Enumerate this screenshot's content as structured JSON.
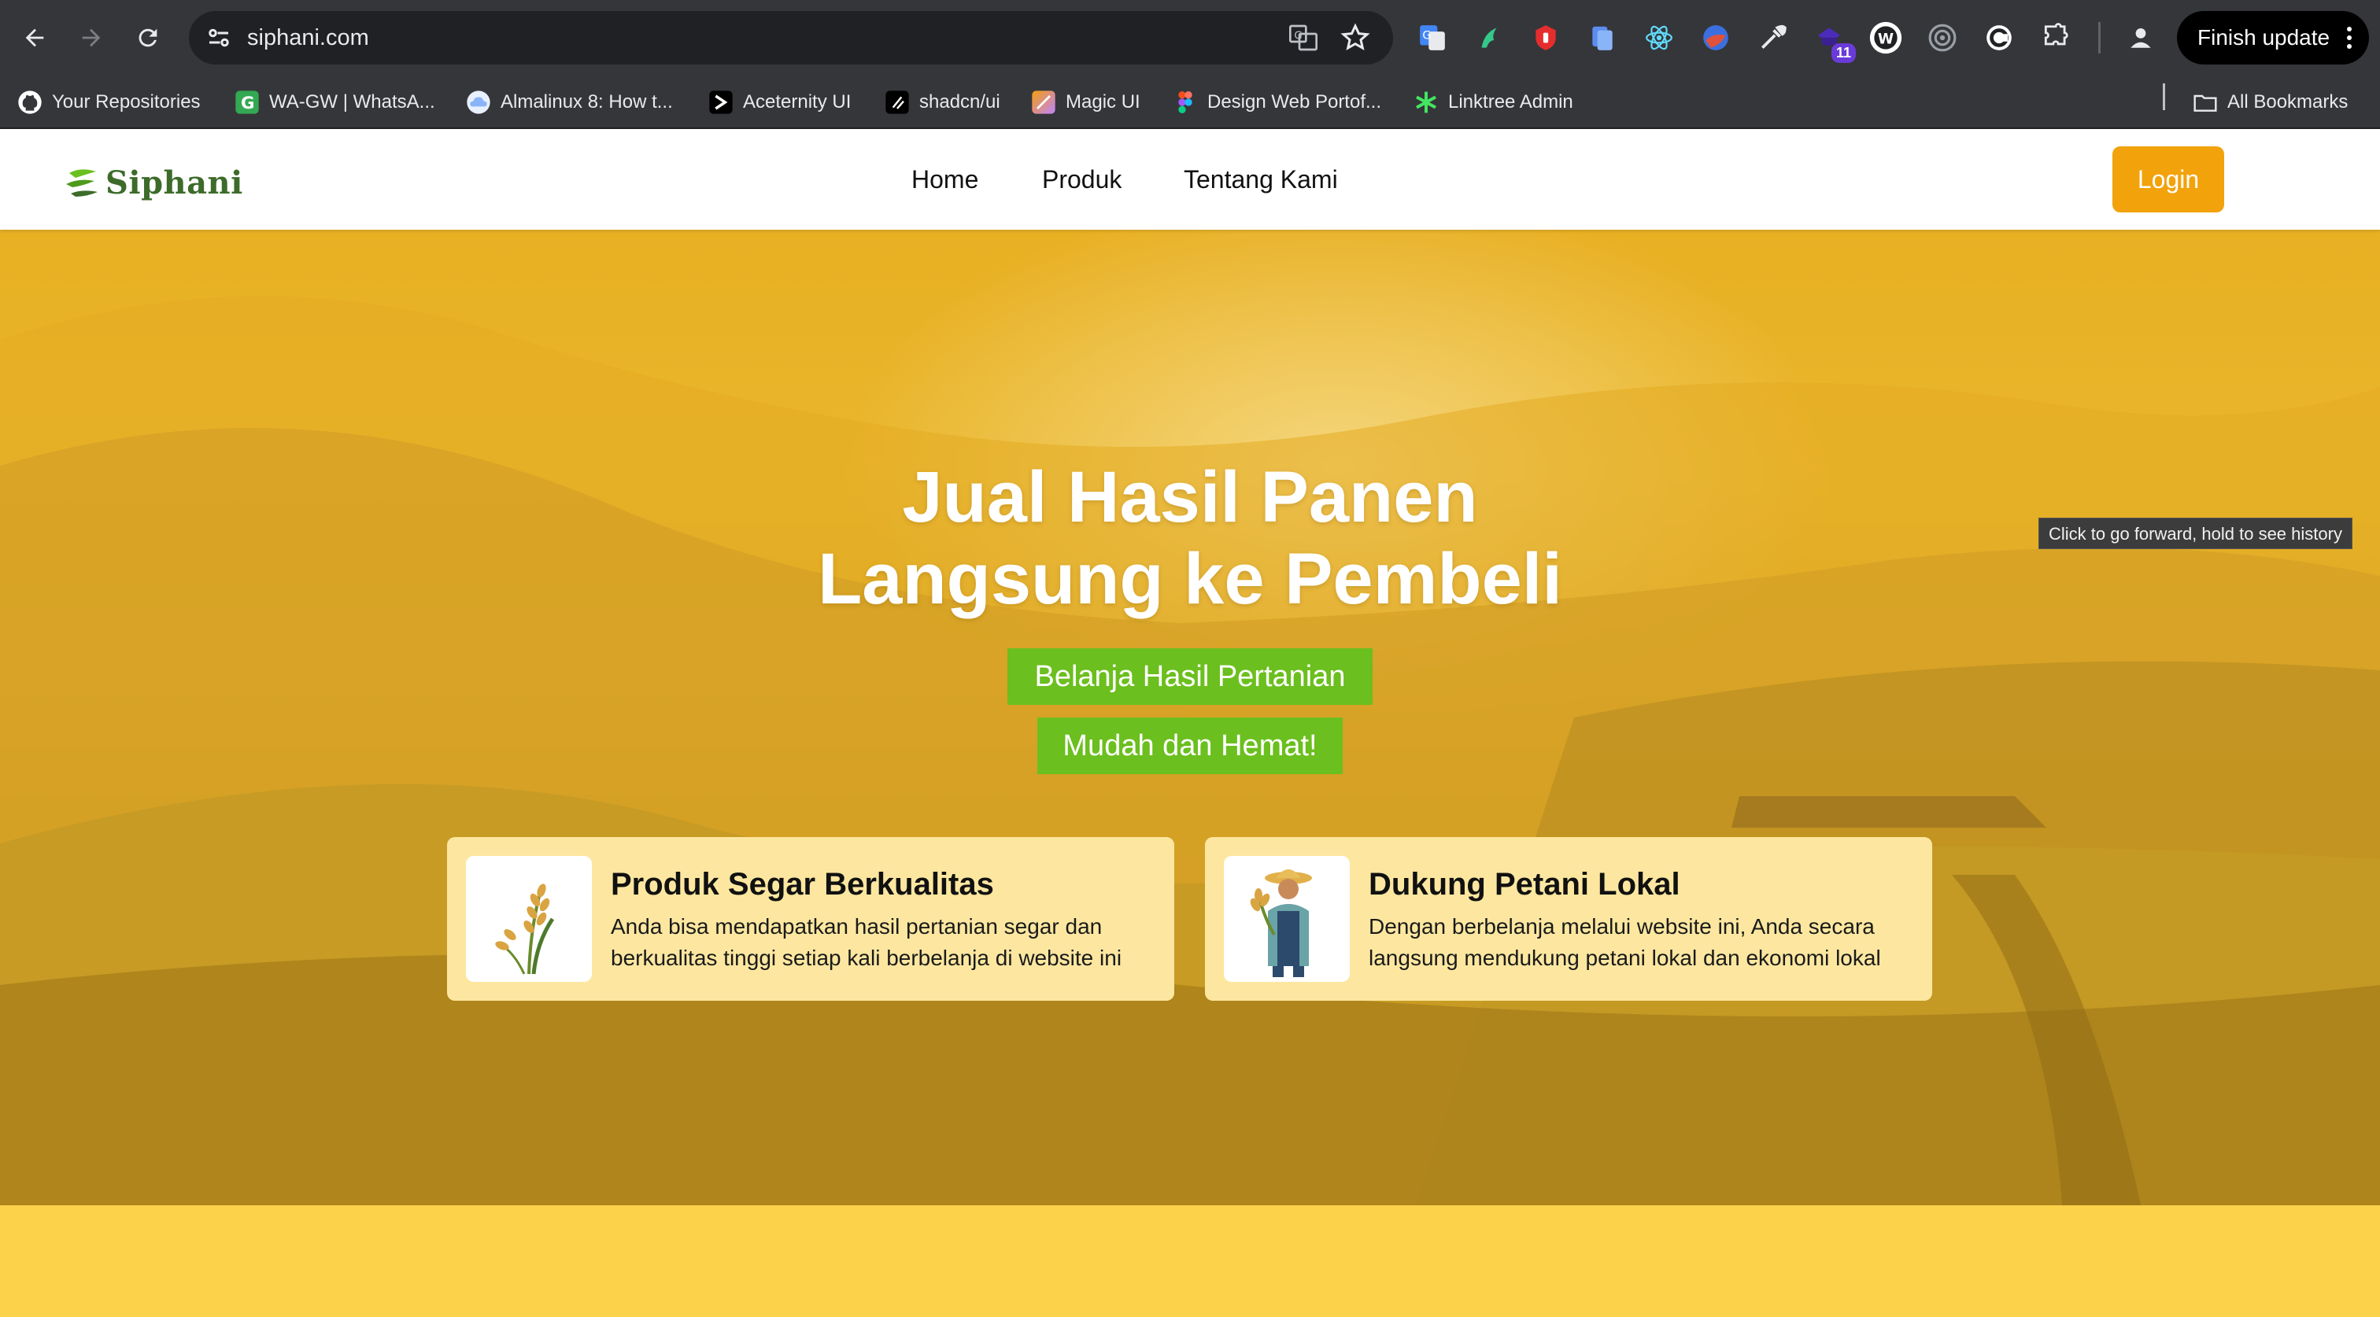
{
  "browser": {
    "url": "siphani.com",
    "finish_update_label": "Finish update",
    "extension_badge": "11",
    "bookmarks": [
      {
        "label": "Your Repositories",
        "icon": "github-icon",
        "color": "#ffffff"
      },
      {
        "label": "WA-GW | WhatsA...",
        "icon": "green-g-icon",
        "color": "#34a853"
      },
      {
        "label": "Almalinux 8: How t...",
        "icon": "cloud-icon",
        "color": "#8ab4f8"
      },
      {
        "label": "Aceternity UI",
        "icon": "chevron-icon",
        "color": "#000000"
      },
      {
        "label": "shadcn/ui",
        "icon": "slash-icon",
        "color": "#000000"
      },
      {
        "label": "Magic UI",
        "icon": "magic-icon",
        "color": "#c58af9"
      },
      {
        "label": "Design Web Portof...",
        "icon": "figma-icon",
        "color": "#f24e1e"
      },
      {
        "label": "Linktree Admin",
        "icon": "asterisk-icon",
        "color": "#43e660"
      }
    ],
    "all_bookmarks_label": "All Bookmarks",
    "tooltip": "Click to go forward, hold to see history"
  },
  "site": {
    "logo_text": "Siphani",
    "nav": [
      "Home",
      "Produk",
      "Tentang Kami"
    ],
    "login_label": "Login",
    "hero": {
      "title_line1": "Jual Hasil Panen",
      "title_line2": "Langsung ke Pembeli",
      "pill1": "Belanja Hasil Pertanian",
      "pill2": "Mudah dan Hemat!"
    },
    "features": [
      {
        "title": "Produk Segar Berkualitas",
        "text": "Anda bisa mendapatkan hasil pertanian segar dan berkualitas tinggi setiap kali berbelanja di website ini",
        "icon": "rice-stalk-icon"
      },
      {
        "title": "Dukung Petani Lokal",
        "text": "Dengan berbelanja melalui website ini, Anda secara langsung mendukung petani lokal dan ekonomi lokal",
        "icon": "farmer-icon"
      }
    ]
  },
  "colors": {
    "accent_orange": "#f2a20b",
    "pill_green": "#6bbf1e",
    "card_bg": "#fde7a0",
    "logo_green": "#3d6b2a",
    "section_yellow": "#fcd24a"
  }
}
